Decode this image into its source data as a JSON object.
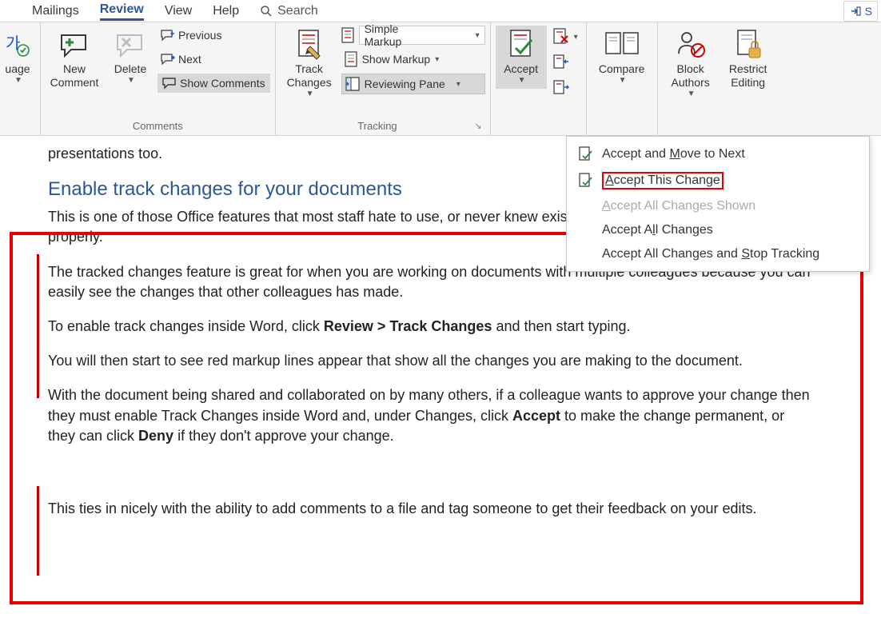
{
  "tabs": {
    "mailings": "Mailings",
    "review": "Review",
    "view": "View",
    "help": "Help",
    "search": "Search"
  },
  "share": "S",
  "ribbon": {
    "language": "uage",
    "comments": {
      "new_comment": "New Comment",
      "delete": "Delete",
      "previous": "Previous",
      "next": "Next",
      "show_comments": "Show Comments",
      "group_label": "Comments"
    },
    "tracking": {
      "track_changes": "Track Changes",
      "simple_markup": "Simple Markup",
      "show_markup": "Show Markup",
      "reviewing_pane": "Reviewing Pane",
      "group_label": "Tracking"
    },
    "changes": {
      "accept": "Accept"
    },
    "compare": {
      "compare": "Compare"
    },
    "protect": {
      "block_authors": "Block Authors",
      "restrict_editing": "Restrict Editing"
    }
  },
  "accept_menu": {
    "move_next": "Accept and Move to Next",
    "this_change": "Accept This Change",
    "all_shown": "Accept All Changes Shown",
    "all_changes": "Accept All Changes",
    "all_stop": "Accept All Changes and Stop Tracking"
  },
  "doc": {
    "frag_top": "presentations too.",
    "heading": "Enable track changes for your documents",
    "p1": "This is one of those Office features that most staff hate to use, or never knew existed. It is very useful when used properly.",
    "p2": "The tracked changes feature is great for when you are working on documents with multiple colleagues because you can easily see the changes that other colleagues has made.",
    "p3a": "To enable track changes inside Word, click ",
    "p3b": "Review > Track Changes",
    "p3c": " and then start typing.",
    "p4": "You will then start to see red markup lines appear that show all the changes you are making to the document.",
    "p5a": "With the document being shared and collaborated on by many others, if a colleague wants to approve your change then they must enable Track Changes inside Word and, under Changes, click ",
    "p5b": "Accept",
    "p5c": " to make the change permanent, or they can click ",
    "p5d": "Deny",
    "p5e": " if they don't approve your change.",
    "p6": "This ties in nicely with the ability to add comments to a file and tag someone to get their feedback on your edits."
  }
}
